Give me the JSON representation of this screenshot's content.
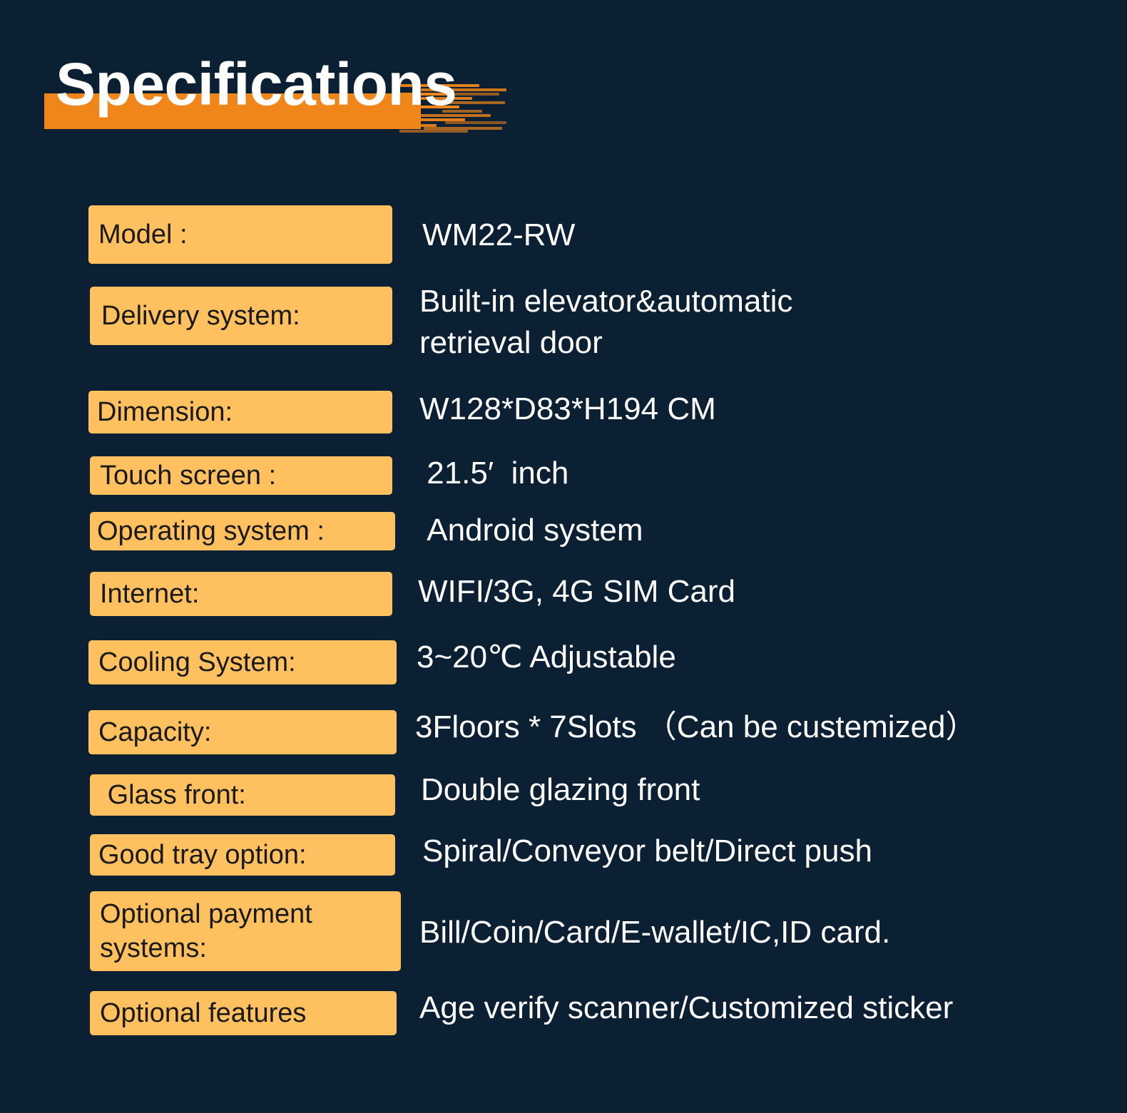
{
  "page": {
    "background_color": "#0c2033",
    "accent_bar_color": "#f08519",
    "label_chip_color": "#ffc160",
    "label_text_color": "#1a1a1a",
    "value_text_color": "#ffffff"
  },
  "header": {
    "title": "Specifications"
  },
  "specs": [
    {
      "label": "Model :",
      "value": "WM22-RW"
    },
    {
      "label": "Delivery system:",
      "value": "Built-in elevator&automatic\nretrieval door"
    },
    {
      "label": "Dimension:",
      "value": "W128*D83*H194 CM"
    },
    {
      "label": "Touch screen :",
      "value": " 21.5′  inch"
    },
    {
      "label": "Operating system :",
      "value": " Android system"
    },
    {
      "label": "Internet:",
      "value": "WIFI/3G, 4G SIM Card"
    },
    {
      "label": "Cooling System:",
      "value": "3~20℃ Adjustable"
    },
    {
      "label": "Capacity:",
      "value": "3Floors * 7Slots （Can be custemized）"
    },
    {
      "label": " Glass front:",
      "value": "Double glazing front"
    },
    {
      "label": "Good tray option:",
      "value": "Spiral/Conveyor belt/Direct push"
    },
    {
      "label": "Optional payment\nsystems:",
      "value": "Bill/Coin/Card/E-wallet/IC,ID card."
    },
    {
      "label": "Optional features",
      "value": "Age verify scanner/Customized sticker"
    }
  ]
}
